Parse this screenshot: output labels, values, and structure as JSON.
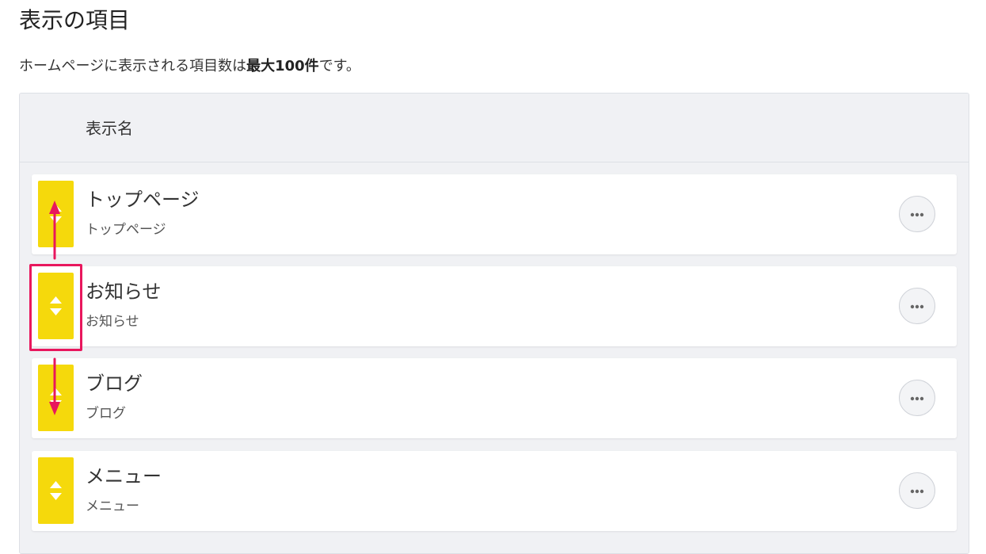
{
  "page": {
    "title": "表示の項目",
    "intro_prefix": "ホームページに表示される項目数は",
    "intro_strong": "最大100件",
    "intro_suffix": "です。"
  },
  "table": {
    "header": "表示名",
    "rows": [
      {
        "title": "トップページ",
        "subtitle": "トップページ"
      },
      {
        "title": "お知らせ",
        "subtitle": "お知らせ"
      },
      {
        "title": "ブログ",
        "subtitle": "ブログ"
      },
      {
        "title": "メニュー",
        "subtitle": "メニュー"
      }
    ]
  },
  "icons": {
    "drag_handle": "sort-arrows-icon",
    "more": "ellipsis-icon",
    "annotation_arrow": "arrow-icon"
  },
  "colors": {
    "handle": "#f5d90c",
    "annotation": "#e8175d",
    "panel_bg": "#f0f1f4"
  }
}
